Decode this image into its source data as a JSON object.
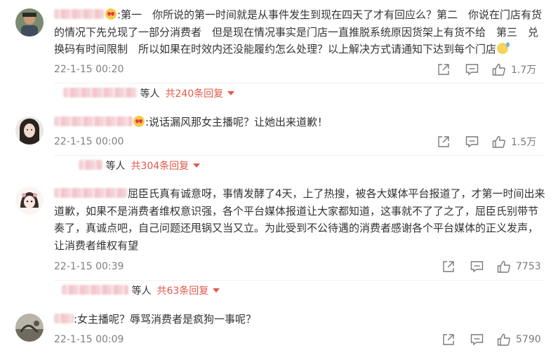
{
  "comments": [
    {
      "text": ":第一　你所说的第一时间就是从事件发生到现在四天了才有回应么？第二　你说在门店有货的情况下先兑现了一部分消费者　但是现在情况事实是门店一直推脱系统原因货架上有货不给　第三　兑换码有时间限制　所以如果在时效内还没能履约怎么处理？以上解决方式请通知下达到每个门店",
      "time": "22-1-15 00:20",
      "likes": "1.7万",
      "reply_suffix": "等人",
      "reply_more": "共240条回复"
    },
    {
      "text": ":说话漏风那女主播呢？让她出来道歉！",
      "time": "22-1-15 00:00",
      "likes": "1.5万",
      "reply_suffix": "等人",
      "reply_more": "共304条回复"
    },
    {
      "text": "屈臣氏真有诚意呀，事情发酵了4天，上了热搜，被各大媒体平台报道了，才第一时间出来道歉，如果不是消费者维权意识强，各个平台媒体报道让大家都知道，这事就不了了之了，屈臣氏别带节奏了，真诚点吧，自己问题还甩锅又当又立。为此受到不公待遇的消费者感谢各个平台媒体的正义发声，让消费者维权有望",
      "time": "22-1-15 00:39",
      "likes": "7753",
      "reply_suffix": "等人",
      "reply_more": "共63条回复"
    },
    {
      "text": ":女主播呢？辱骂消费者是疯狗一事呢？",
      "time": "22-1-15 00:09",
      "likes": "5790"
    }
  ],
  "icons": {
    "share": "share-icon",
    "comment": "comment-icon",
    "like": "thumbs-up-icon"
  },
  "colors": {
    "reply_more": "#e4584a",
    "meta": "#808080"
  }
}
